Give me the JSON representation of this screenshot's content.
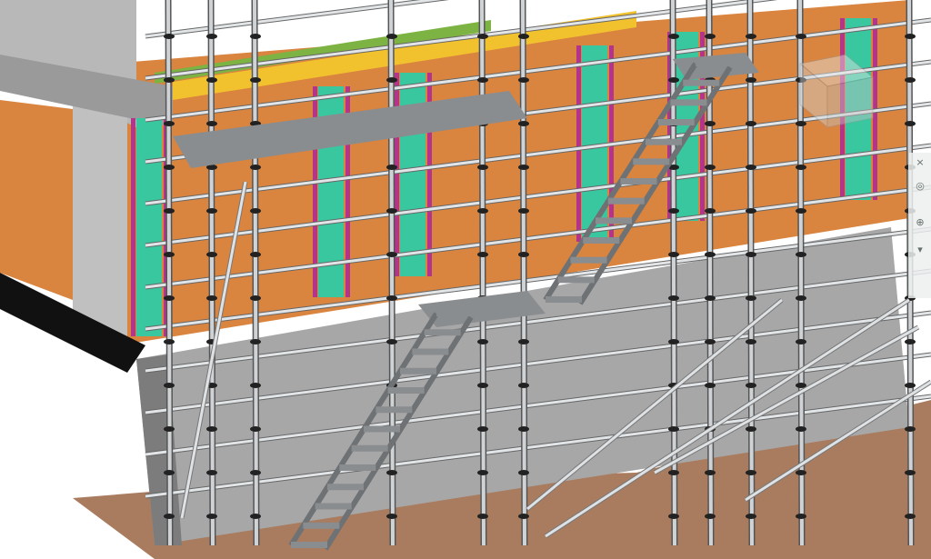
{
  "view": {
    "type": "3d-model-viewport",
    "colors": {
      "background": "#ffffff",
      "wall": "#d9843f",
      "concrete": "#9e9e9e",
      "steel": "#cfd3d6",
      "deck_steel": "#8a8d90",
      "formwork_teal": "#39c7a0",
      "formwork_magenta": "#b5348b",
      "beam_yellow": "#f2c12e",
      "beam_green": "#7cb342",
      "ground": "#a97c5f"
    }
  },
  "nav_widget": {
    "icons": [
      "close-icon",
      "steering-wheel-icon",
      "zoom-icon",
      "navigation-arrow-icon"
    ]
  }
}
